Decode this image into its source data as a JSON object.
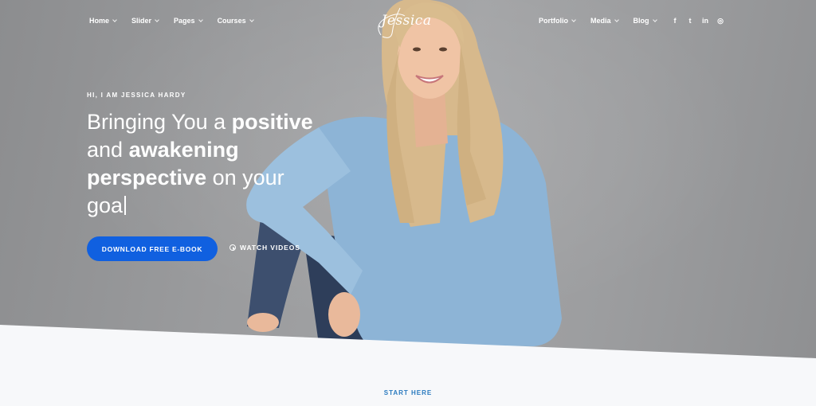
{
  "logo": {
    "text": "Jessica"
  },
  "nav": {
    "left": [
      {
        "label": "Home"
      },
      {
        "label": "Slider"
      },
      {
        "label": "Pages"
      },
      {
        "label": "Courses"
      }
    ],
    "right": [
      {
        "label": "Portfolio"
      },
      {
        "label": "Media"
      },
      {
        "label": "Blog"
      }
    ],
    "social": [
      {
        "icon": "facebook-icon",
        "glyph": "f"
      },
      {
        "icon": "twitter-icon",
        "glyph": "t"
      },
      {
        "icon": "linkedin-icon",
        "glyph": "in"
      },
      {
        "icon": "instagram-icon",
        "glyph": "◎"
      }
    ]
  },
  "hero": {
    "eyebrow": "HI, I AM JESSICA HARDY",
    "headline": {
      "l1a": "Bringing You a ",
      "l1b": "positive",
      "l2a": "and ",
      "l2b": "awakening",
      "l3a": "perspective",
      "l3b": " on your",
      "l4": "goa"
    },
    "cta_label": "DOWNLOAD FREE E-BOOK",
    "watch_label": "WATCH VIDEOS"
  },
  "section": {
    "start_here": "START HERE"
  },
  "colors": {
    "accent": "#1060e0",
    "hero_bg": "#9a9b9d",
    "section_bg": "#f7f8fa",
    "start_here": "#2a7abf"
  }
}
